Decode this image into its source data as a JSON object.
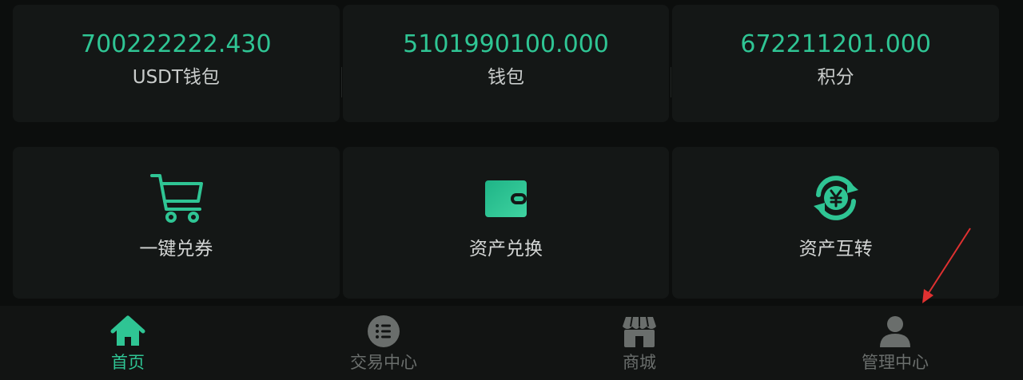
{
  "balances": [
    {
      "value": "700222222.430",
      "label": "USDT钱包"
    },
    {
      "value": "5101990100.000",
      "label": "钱包"
    },
    {
      "value": "672211201.000",
      "label": "积分"
    }
  ],
  "actions": [
    {
      "label": "一键兑券",
      "icon": "shopping-cart-icon"
    },
    {
      "label": "资产兑换",
      "icon": "wallet-icon"
    },
    {
      "label": "资产互转",
      "icon": "yuan-exchange-icon"
    }
  ],
  "tabs": [
    {
      "label": "首页",
      "icon": "home-icon",
      "active": true
    },
    {
      "label": "交易中心",
      "icon": "list-icon",
      "active": false
    },
    {
      "label": "商城",
      "icon": "store-icon",
      "active": false
    },
    {
      "label": "管理中心",
      "icon": "user-icon",
      "active": false
    }
  ],
  "colors": {
    "accent": "#2fc594",
    "card": "#141716",
    "background": "#0c0e0d",
    "inactive_tab": "#6a6e6c",
    "annotation": "#e03131"
  }
}
